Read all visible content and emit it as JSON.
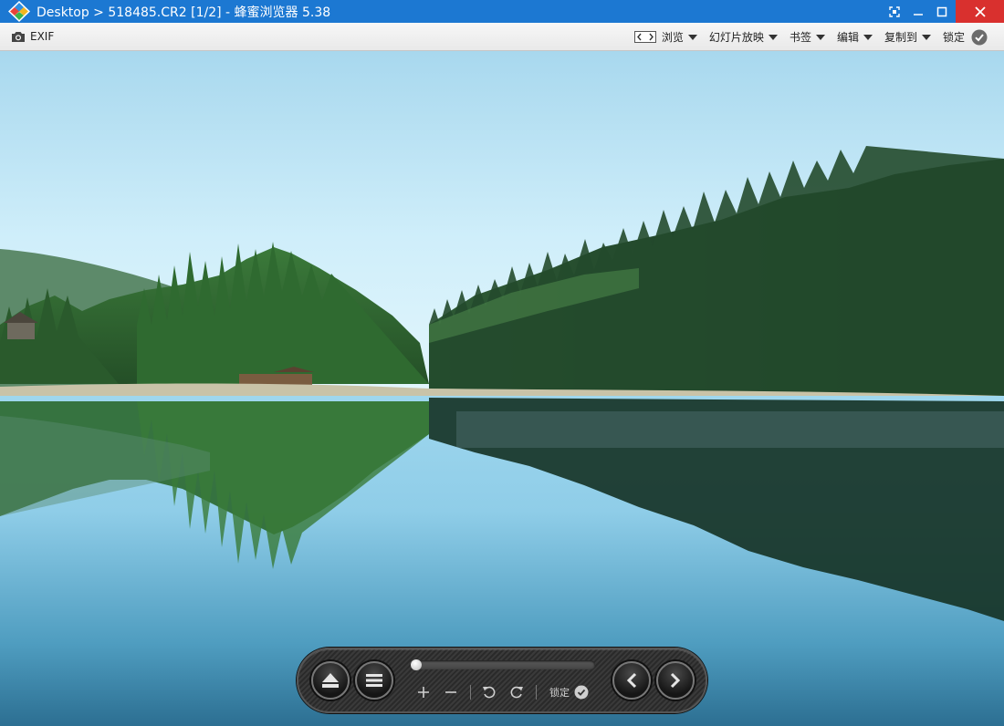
{
  "window": {
    "title": "Desktop > 518485.CR2 [1/2] - 蜂蜜浏览器 5.38",
    "controls": [
      "fullscreen-icon",
      "minimize-icon",
      "maximize-icon",
      "close-icon"
    ],
    "title_bar_color": "#1c78d2",
    "close_color": "#d9302e"
  },
  "toolbar": {
    "exif_label": "EXIF",
    "menus": [
      {
        "label": "浏览",
        "icon": "browse-icon"
      },
      {
        "label": "幻灯片放映"
      },
      {
        "label": "书签"
      },
      {
        "label": "编辑"
      },
      {
        "label": "复制到"
      }
    ],
    "lock_label": "锁定"
  },
  "photo": {
    "subject": "mountain lake with pine forest reflection"
  },
  "panel": {
    "progress": 0.0,
    "lock_label": "锁定",
    "buttons": [
      "eject-icon",
      "menu-icon",
      "zoom-in-icon",
      "zoom-out-icon",
      "rotate-left-icon",
      "rotate-right-icon",
      "prev-icon",
      "next-icon"
    ]
  }
}
